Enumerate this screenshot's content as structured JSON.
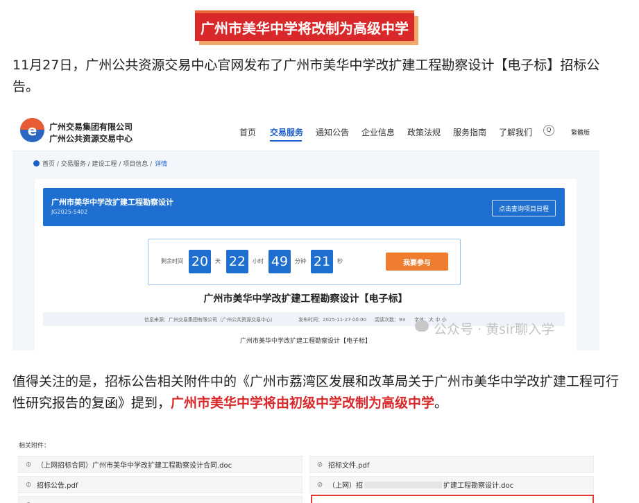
{
  "banner": {
    "title": "广州市美华中学将改制为高级中学"
  },
  "intro": {
    "text": "11月27日，广州公共资源交易中心官网发布了广州市美华中学改扩建工程勘察设计【电子标】招标公告。"
  },
  "site": {
    "org_line1": "广州交易集团有限公司",
    "org_line2": "广州公共资源交易中心",
    "nav": [
      "首页",
      "交易服务",
      "通知公告",
      "企业信息",
      "政策法规",
      "服务指南",
      "了解我们"
    ],
    "search_glyph": "Q",
    "traditional": "繁體版",
    "breadcrumb": {
      "path": "首页 / 交易服务 / 建设工程 / 项目信息 /",
      "current": "详情"
    },
    "card": {
      "title": "广州市美华中学改扩建工程勘察设计",
      "code": "JG2025-5402",
      "query_button": "点击查询项目日程",
      "countdown": {
        "label": "剩余时间",
        "days": "20",
        "days_unit": "天",
        "hours": "22",
        "hours_unit": "小时",
        "minutes": "49",
        "minutes_unit": "分钟",
        "seconds": "21",
        "seconds_unit": "秒"
      },
      "join_button": "我要参与",
      "project_title": "广州市美华中学改扩建工程勘察设计【电子标】",
      "meta": {
        "source": "信息来源：广州交易集团有限公司（广州公共资源交易中心）",
        "publish": "发布时间：2025-11-27 00:00",
        "views": "阅读次数：93",
        "font": "字体：大 中 小"
      },
      "file_caption": "广州市美华中学改扩建工程勘察设计【电子标】"
    }
  },
  "watermark": {
    "text": "公众号 · 黄sir聊入学"
  },
  "para2": {
    "before": "值得关注的是，招标公告相关附件中的《广州市荔湾区发展和改革局关于广州市美华中学改扩建工程可行性研究报告的复函》提到，",
    "highlight": "广州市美华中学将由初级中学改制为高级中学",
    "after": "。"
  },
  "attachments": {
    "label": "相关附件：",
    "items": [
      "（上网招标合同）广州市美华中学改扩建工程勘察设计合同.doc",
      "招标文件.pdf",
      "招标公告.pdf"
    ],
    "partial_left": "（上网）招",
    "partial_right": "扩建工程勘察设计.doc"
  }
}
